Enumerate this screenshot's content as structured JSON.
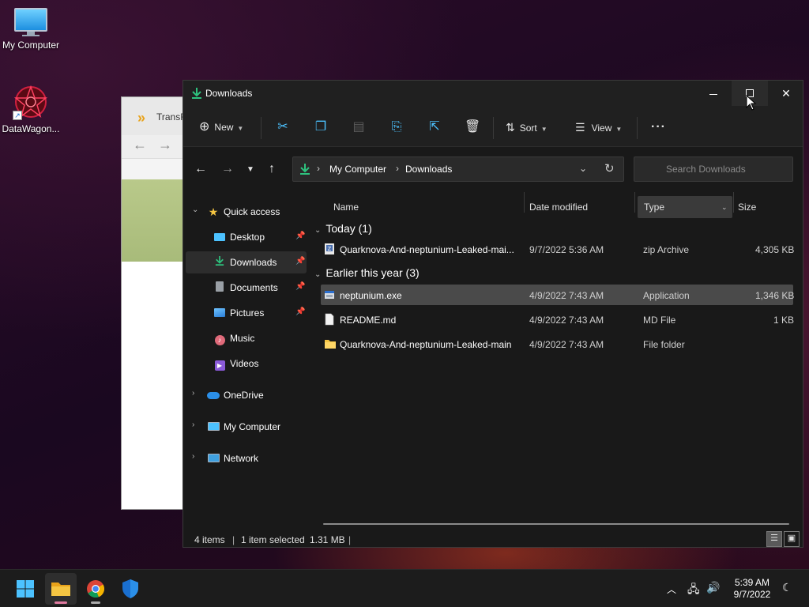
{
  "desktop": {
    "icons": [
      {
        "label": "My Computer",
        "icon": "monitor-icon"
      },
      {
        "label": "DataWagon...",
        "icon": "datawagon-icon"
      }
    ]
  },
  "background_window": {
    "title": "TransF"
  },
  "explorer": {
    "title": "Downloads",
    "toolbar": {
      "new_label": "New",
      "sort_label": "Sort",
      "view_label": "View",
      "more_label": "···"
    },
    "address": {
      "crumbs": [
        "My Computer",
        "Downloads"
      ]
    },
    "search": {
      "placeholder": "Search Downloads"
    },
    "sidebar": {
      "items": [
        {
          "label": "Quick access",
          "icon": "star-icon",
          "pinned": false
        },
        {
          "label": "Desktop",
          "icon": "desktop-icon",
          "pinned": true
        },
        {
          "label": "Downloads",
          "icon": "download-icon",
          "pinned": true,
          "selected": true
        },
        {
          "label": "Documents",
          "icon": "documents-icon",
          "pinned": true
        },
        {
          "label": "Pictures",
          "icon": "pictures-icon",
          "pinned": true
        },
        {
          "label": "Music",
          "icon": "music-icon",
          "pinned": false
        },
        {
          "label": "Videos",
          "icon": "videos-icon",
          "pinned": false
        },
        {
          "label": "OneDrive",
          "icon": "cloud-icon",
          "pinned": false
        },
        {
          "label": "My Computer",
          "icon": "computer-icon",
          "pinned": false
        },
        {
          "label": "Network",
          "icon": "network-icon",
          "pinned": false
        }
      ]
    },
    "columns": {
      "name": "Name",
      "date": "Date modified",
      "type": "Type",
      "size": "Size"
    },
    "groups": [
      {
        "header": "Today (1)",
        "rows": [
          {
            "name": "Quarknova-And-neptunium-Leaked-mai...",
            "date": "9/7/2022 5:36 AM",
            "type": "zip Archive",
            "size": "4,305 KB",
            "icon": "zip-icon"
          }
        ]
      },
      {
        "header": "Earlier this year (3)",
        "rows": [
          {
            "name": "neptunium.exe",
            "date": "4/9/2022 7:43 AM",
            "type": "Application",
            "size": "1,346 KB",
            "icon": "exe-icon",
            "selected": true
          },
          {
            "name": "README.md",
            "date": "4/9/2022 7:43 AM",
            "type": "MD File",
            "size": "1 KB",
            "icon": "file-icon"
          },
          {
            "name": "Quarknova-And-neptunium-Leaked-main",
            "date": "4/9/2022 7:43 AM",
            "type": "File folder",
            "size": "",
            "icon": "folder-icon"
          }
        ]
      }
    ],
    "status": {
      "items": "4 items",
      "selected": "1 item selected",
      "size": "1.31 MB"
    }
  },
  "taskbar": {
    "clock_time": "5:39 AM",
    "clock_date": "9/7/2022"
  },
  "colors": {
    "accent": "#4cc2ff",
    "download_green": "#2ec27e",
    "folder_yellow": "#f5c542"
  }
}
